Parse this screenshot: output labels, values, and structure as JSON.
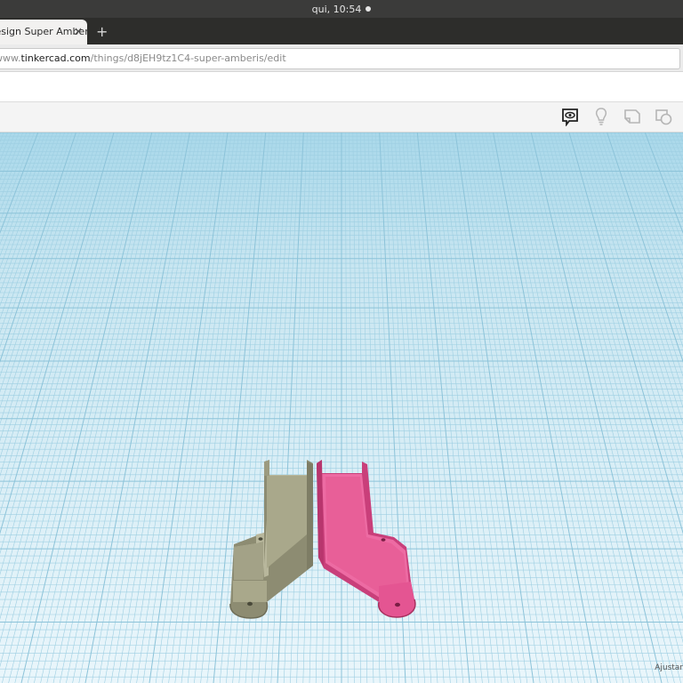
{
  "system": {
    "clock": "qui, 10:54"
  },
  "browser": {
    "tab_title": "Design Super Amberis",
    "tab_close": "×",
    "new_tab": "+",
    "url_prefix": "www.",
    "url_host": "tinkercad.com",
    "url_path": "/things/d8jEH9tz1C4-super-amberis/edit"
  },
  "toolbar": {
    "icons": [
      "comment-eye-icon",
      "lightbulb-icon",
      "shape-note-icon",
      "group-icon"
    ]
  },
  "workplane": {
    "grid_color": "#9ecfe2",
    "background_color": "#d8eef6",
    "shapes": [
      {
        "name": "left-bracket",
        "color": "#a9a88b"
      },
      {
        "name": "right-bracket",
        "color": "#e85f98"
      }
    ],
    "hint": "Ajustar"
  }
}
